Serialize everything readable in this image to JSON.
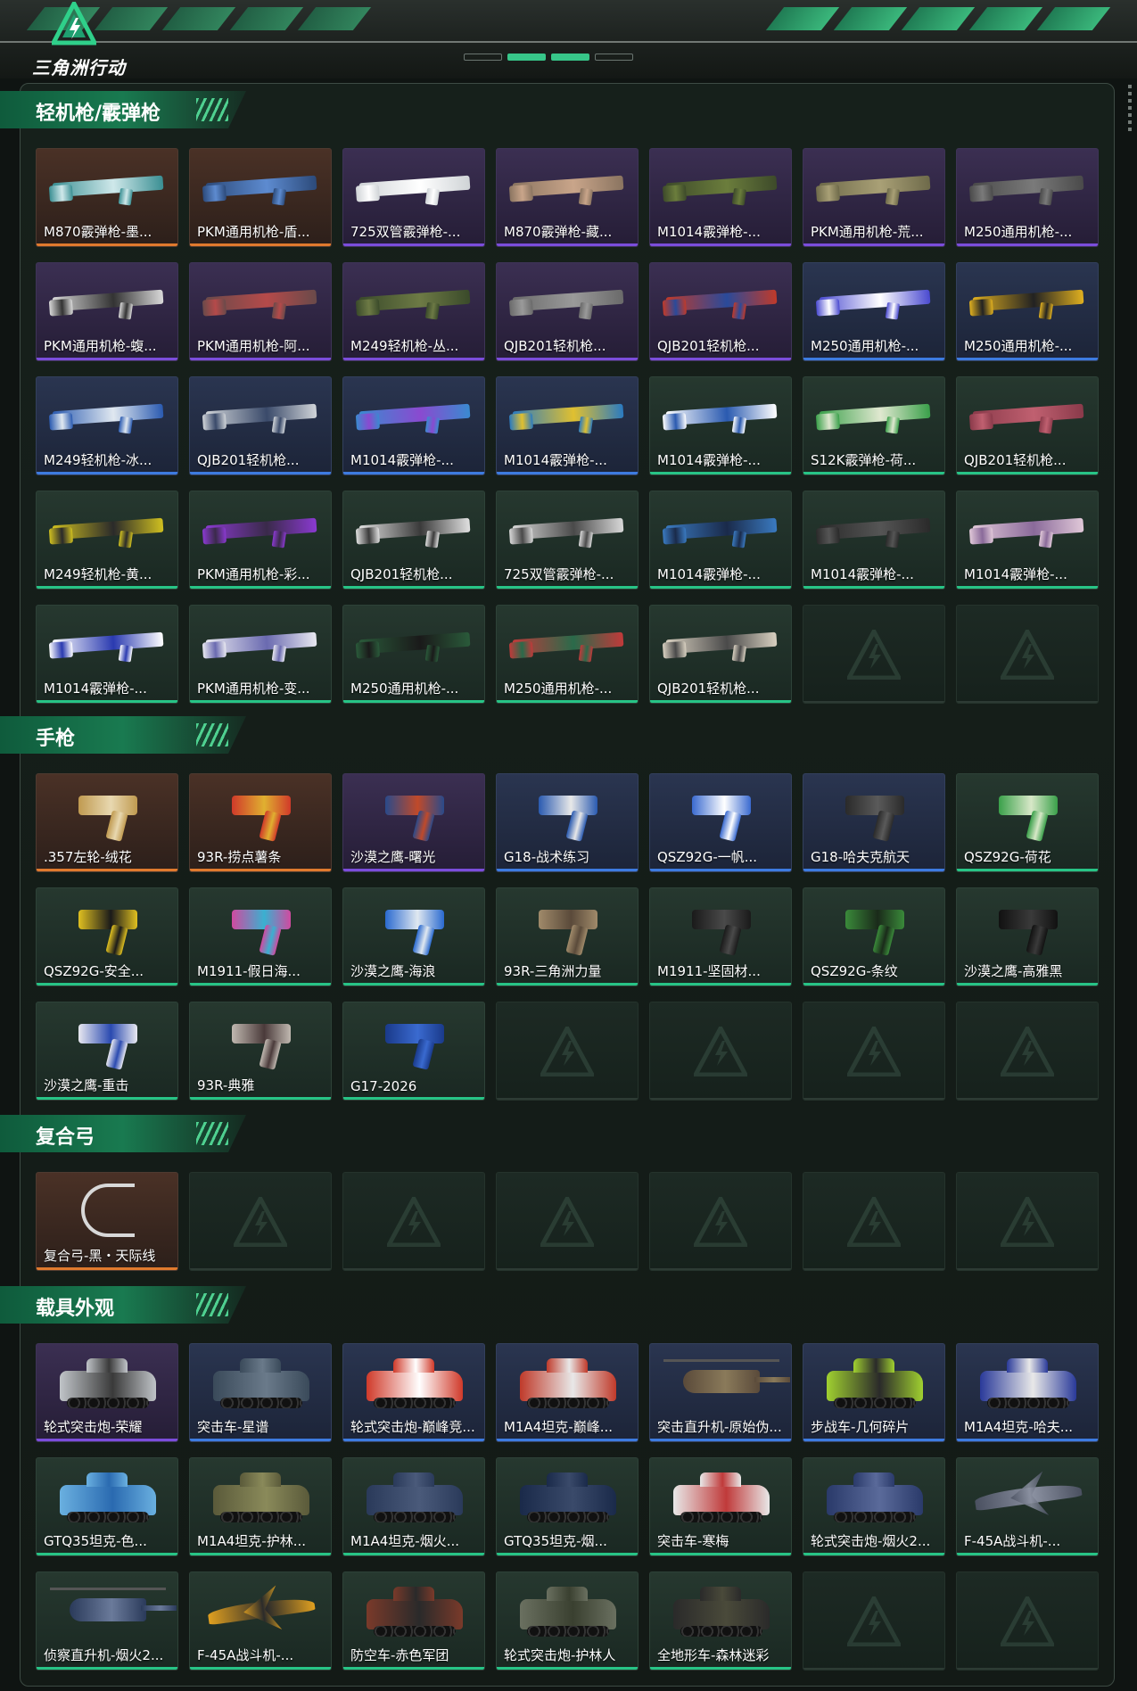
{
  "header": {
    "logo_text": "三角洲行动",
    "accent_color": "#2fd08a"
  },
  "sections": [
    {
      "title": "轻机枪/霰弹枪",
      "items": [
        {
          "label": "M870霰弹枪-墨...",
          "rarity": "orange",
          "kind": "long",
          "colors": [
            "#3a8f93",
            "#cfe8ea"
          ]
        },
        {
          "label": "PKM通用机枪-盾...",
          "rarity": "orange",
          "kind": "long",
          "colors": [
            "#2c4a7a",
            "#5d8bd0"
          ]
        },
        {
          "label": "725双管霰弹枪-...",
          "rarity": "purple",
          "kind": "long",
          "colors": [
            "#cfd3d6",
            "#ffffff"
          ]
        },
        {
          "label": "M870霰弹枪-藏...",
          "rarity": "purple",
          "kind": "long",
          "colors": [
            "#8a7460",
            "#c9a58a"
          ]
        },
        {
          "label": "M1014霰弹枪-...",
          "rarity": "purple",
          "kind": "long",
          "colors": [
            "#3d4a2a",
            "#6b7d3c"
          ]
        },
        {
          "label": "PKM通用机枪-荒...",
          "rarity": "purple",
          "kind": "long",
          "colors": [
            "#6e6a4a",
            "#a9a076"
          ]
        },
        {
          "label": "M250通用机枪-...",
          "rarity": "purple",
          "kind": "long",
          "colors": [
            "#4a4a4a",
            "#7a7a7a"
          ]
        },
        {
          "label": "PKM通用机枪-蝮...",
          "rarity": "purple",
          "kind": "long",
          "colors": [
            "#d9d9d9",
            "#333333"
          ]
        },
        {
          "label": "PKM通用机枪-阿...",
          "rarity": "purple",
          "kind": "long",
          "colors": [
            "#6a4a4a",
            "#b54a4a"
          ]
        },
        {
          "label": "M249轻机枪-丛...",
          "rarity": "purple",
          "kind": "long",
          "colors": [
            "#3a4a2a",
            "#6d7a45"
          ]
        },
        {
          "label": "QJB201轻机枪...",
          "rarity": "purple",
          "kind": "long",
          "colors": [
            "#6a6a6a",
            "#9a9a9a"
          ]
        },
        {
          "label": "QJB201轻机枪...",
          "rarity": "purple",
          "kind": "long",
          "colors": [
            "#c03a2a",
            "#2a4a9a"
          ]
        },
        {
          "label": "M250通用机枪-...",
          "rarity": "blue",
          "kind": "long",
          "colors": [
            "#4a4ad0",
            "#ffffff"
          ]
        },
        {
          "label": "M250通用机枪-...",
          "rarity": "blue",
          "kind": "long",
          "colors": [
            "#e0b020",
            "#222222"
          ]
        },
        {
          "label": "M249轻机枪-冰...",
          "rarity": "blue",
          "kind": "long",
          "colors": [
            "#2a5ab0",
            "#e0e8f0"
          ]
        },
        {
          "label": "QJB201轻机枪...",
          "rarity": "blue",
          "kind": "long",
          "colors": [
            "#d0d4d8",
            "#3a4a6a"
          ]
        },
        {
          "label": "M1014霰弹枪-...",
          "rarity": "blue",
          "kind": "long",
          "colors": [
            "#3a8ad0",
            "#8a4ad0"
          ]
        },
        {
          "label": "M1014霰弹枪-...",
          "rarity": "blue",
          "kind": "long",
          "colors": [
            "#2a7ac0",
            "#e0c030"
          ]
        },
        {
          "label": "M1014霰弹枪-...",
          "rarity": "green",
          "kind": "long",
          "colors": [
            "#ffffff",
            "#2a5ab0"
          ]
        },
        {
          "label": "S12K霰弹枪-荷...",
          "rarity": "green",
          "kind": "long",
          "colors": [
            "#3aa04a",
            "#e0e8d0"
          ]
        },
        {
          "label": "QJB201轻机枪...",
          "rarity": "green",
          "kind": "long",
          "colors": [
            "#8a3a4a",
            "#c06070"
          ]
        },
        {
          "label": "M249轻机枪-黄...",
          "rarity": "green",
          "kind": "long",
          "colors": [
            "#d0c020",
            "#2a2a2a"
          ]
        },
        {
          "label": "PKM通用机枪-彩...",
          "rarity": "green",
          "kind": "long",
          "colors": [
            "#8a3ad0",
            "#3a2a4a"
          ]
        },
        {
          "label": "QJB201轻机枪...",
          "rarity": "green",
          "kind": "long",
          "colors": [
            "#e0e0e0",
            "#3a3a3a"
          ]
        },
        {
          "label": "725双管霰弹枪-...",
          "rarity": "green",
          "kind": "long",
          "colors": [
            "#d8d8d8",
            "#4a4a4a"
          ]
        },
        {
          "label": "M1014霰弹枪-...",
          "rarity": "green",
          "kind": "long",
          "colors": [
            "#3a7ac0",
            "#1a2a4a"
          ]
        },
        {
          "label": "M1014霰弹枪-...",
          "rarity": "green",
          "kind": "long",
          "colors": [
            "#2a2a2a",
            "#555555"
          ]
        },
        {
          "label": "M1014霰弹枪-...",
          "rarity": "green",
          "kind": "long",
          "colors": [
            "#e0c8d8",
            "#8a6a9a"
          ]
        },
        {
          "label": "M1014霰弹枪-...",
          "rarity": "green",
          "kind": "long",
          "colors": [
            "#ffffff",
            "#2a3ab0"
          ]
        },
        {
          "label": "PKM通用机枪-变...",
          "rarity": "green",
          "kind": "long",
          "colors": [
            "#e8e8f0",
            "#6a6ab0"
          ]
        },
        {
          "label": "M250通用机枪-...",
          "rarity": "green",
          "kind": "long",
          "colors": [
            "#2a5a3a",
            "#1a1a1a"
          ]
        },
        {
          "label": "M250通用机枪-...",
          "rarity": "green",
          "kind": "long",
          "colors": [
            "#c03a3a",
            "#2a6a4a"
          ]
        },
        {
          "label": "QJB201轻机枪...",
          "rarity": "green",
          "kind": "long",
          "colors": [
            "#d8d0c0",
            "#4a4a4a"
          ]
        },
        {
          "empty": true
        },
        {
          "empty": true
        }
      ]
    },
    {
      "title": "手枪",
      "items": [
        {
          "label": ".357左轮-绒花",
          "rarity": "orange",
          "kind": "pistol",
          "colors": [
            "#c09a50",
            "#e8d8b0"
          ]
        },
        {
          "label": "93R-捞点薯条",
          "rarity": "orange",
          "kind": "pistol",
          "colors": [
            "#d03a2a",
            "#e0b030"
          ]
        },
        {
          "label": "沙漠之鹰-曙光",
          "rarity": "purple",
          "kind": "pistol",
          "colors": [
            "#2a4a8a",
            "#c04a2a"
          ]
        },
        {
          "label": "G18-战术练习",
          "rarity": "blue",
          "kind": "pistol",
          "colors": [
            "#2a5ab0",
            "#e8e8e8"
          ]
        },
        {
          "label": "QSZ92G-一帆...",
          "rarity": "blue",
          "kind": "pistol",
          "colors": [
            "#3a6ad0",
            "#ffffff"
          ]
        },
        {
          "label": "G18-哈夫克航天",
          "rarity": "blue",
          "kind": "pistol",
          "colors": [
            "#2a2a2a",
            "#5a5a5a"
          ]
        },
        {
          "label": "QSZ92G-荷花",
          "rarity": "green",
          "kind": "pistol",
          "colors": [
            "#3aa04a",
            "#d8e8c8"
          ]
        },
        {
          "label": "QSZ92G-安全...",
          "rarity": "green",
          "kind": "pistol",
          "colors": [
            "#e0c020",
            "#1a1a1a"
          ]
        },
        {
          "label": "M1911-假日海...",
          "rarity": "green",
          "kind": "pistol",
          "colors": [
            "#d04aa0",
            "#3ab0d0"
          ]
        },
        {
          "label": "沙漠之鹰-海浪",
          "rarity": "green",
          "kind": "pistol",
          "colors": [
            "#2a6ad0",
            "#e0e8f0"
          ]
        },
        {
          "label": "93R-三角洲力量",
          "rarity": "green",
          "kind": "pistol",
          "colors": [
            "#a08a6a",
            "#5a4a3a"
          ]
        },
        {
          "label": "M1911-坚固材...",
          "rarity": "green",
          "kind": "pistol",
          "colors": [
            "#1a1a1a",
            "#4a4a4a"
          ]
        },
        {
          "label": "QSZ92G-条纹",
          "rarity": "green",
          "kind": "pistol",
          "colors": [
            "#3a8a3a",
            "#1a2a1a"
          ]
        },
        {
          "label": "沙漠之鹰-高雅黑",
          "rarity": "green",
          "kind": "pistol",
          "colors": [
            "#111111",
            "#3a3a3a"
          ]
        },
        {
          "label": "沙漠之鹰-重击",
          "rarity": "green",
          "kind": "pistol",
          "colors": [
            "#e8e8f0",
            "#2a4ab0"
          ]
        },
        {
          "label": "93R-典雅",
          "rarity": "green",
          "kind": "pistol",
          "colors": [
            "#c0b8b0",
            "#4a3a3a"
          ]
        },
        {
          "label": "G17-2026",
          "rarity": "green",
          "kind": "pistol",
          "colors": [
            "#1a3a8a",
            "#3a6ad0"
          ]
        },
        {
          "empty": true
        },
        {
          "empty": true
        },
        {
          "empty": true
        },
        {
          "empty": true
        }
      ]
    },
    {
      "title": "复合弓",
      "items": [
        {
          "label": "复合弓-黑・天际线",
          "rarity": "orange",
          "kind": "bow",
          "colors": [
            "#d8d8d8",
            "#2a2a2a"
          ]
        },
        {
          "empty": true
        },
        {
          "empty": true
        },
        {
          "empty": true
        },
        {
          "empty": true
        },
        {
          "empty": true
        },
        {
          "empty": true
        }
      ]
    },
    {
      "title": "载具外观",
      "items": [
        {
          "label": "轮式突击炮-荣耀",
          "rarity": "purple",
          "kind": "vehicle",
          "colors": [
            "#c0c4c8",
            "#3a3a3a"
          ]
        },
        {
          "label": "突击车-星谱",
          "rarity": "blue",
          "kind": "vehicle",
          "colors": [
            "#3a4a5a",
            "#6a7a8a"
          ]
        },
        {
          "label": "轮式突击炮-巅峰竞...",
          "rarity": "blue",
          "kind": "vehicle",
          "colors": [
            "#d03a2a",
            "#ffffff"
          ]
        },
        {
          "label": "M1A4坦克-巅峰...",
          "rarity": "blue",
          "kind": "vehicle",
          "colors": [
            "#c03a2a",
            "#e8e8e8"
          ]
        },
        {
          "label": "突击直升机-原始伪...",
          "rarity": "blue",
          "kind": "heli",
          "colors": [
            "#5a4a3a",
            "#8a7a5a"
          ]
        },
        {
          "label": "步战车-几何碎片",
          "rarity": "blue",
          "kind": "vehicle",
          "colors": [
            "#a0d030",
            "#2a2a2a"
          ]
        },
        {
          "label": "M1A4坦克-哈夫...",
          "rarity": "blue",
          "kind": "vehicle",
          "colors": [
            "#2a3a9a",
            "#e8e8e8"
          ]
        },
        {
          "label": "GTQ35坦克-色...",
          "rarity": "green",
          "kind": "vehicle",
          "colors": [
            "#6ab0e0",
            "#2a6ab0"
          ]
        },
        {
          "label": "M1A4坦克-护林...",
          "rarity": "green",
          "kind": "vehicle",
          "colors": [
            "#5a5a3a",
            "#8a8a5a"
          ]
        },
        {
          "label": "M1A4坦克-烟火...",
          "rarity": "green",
          "kind": "vehicle",
          "colors": [
            "#2a3a5a",
            "#4a5a7a"
          ]
        },
        {
          "label": "GTQ35坦克-烟...",
          "rarity": "green",
          "kind": "vehicle",
          "colors": [
            "#1a2a4a",
            "#3a4a6a"
          ]
        },
        {
          "label": "突击车-寒梅",
          "rarity": "green",
          "kind": "vehicle",
          "colors": [
            "#e8e8e8",
            "#c03a3a"
          ]
        },
        {
          "label": "轮式突击炮-烟火2...",
          "rarity": "green",
          "kind": "vehicle",
          "colors": [
            "#2a3a6a",
            "#5a6a9a"
          ]
        },
        {
          "label": "F-45A战斗机-...",
          "rarity": "green",
          "kind": "jet",
          "colors": [
            "#4a5060",
            "#8a90a0"
          ]
        },
        {
          "label": "侦察直升机-烟火2...",
          "rarity": "green",
          "kind": "heli",
          "colors": [
            "#2a3a5a",
            "#6a7a9a"
          ]
        },
        {
          "label": "F-45A战斗机-...",
          "rarity": "green",
          "kind": "jet",
          "colors": [
            "#e0a020",
            "#2a2a2a"
          ]
        },
        {
          "label": "防空车-赤色军团",
          "rarity": "green",
          "kind": "vehicle",
          "colors": [
            "#7a3a2a",
            "#2a2a2a"
          ]
        },
        {
          "label": "轮式突击炮-护林人",
          "rarity": "green",
          "kind": "vehicle",
          "colors": [
            "#6a7060",
            "#3a4030"
          ]
        },
        {
          "label": "全地形车-森林迷彩",
          "rarity": "green",
          "kind": "vehicle",
          "colors": [
            "#2a2a2a",
            "#4a4a3a"
          ]
        },
        {
          "empty": true
        },
        {
          "empty": true
        }
      ]
    }
  ]
}
